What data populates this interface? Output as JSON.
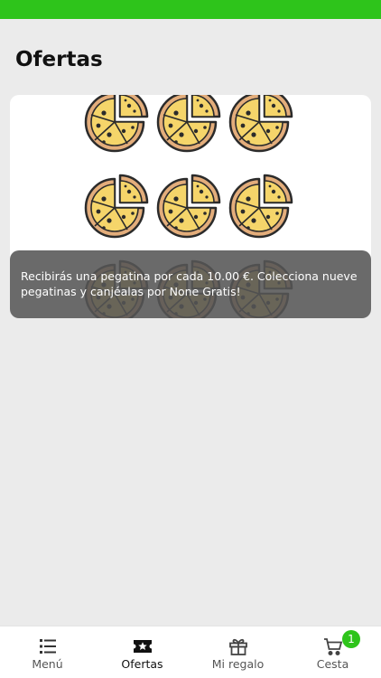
{
  "colors": {
    "accent": "#2ec41b",
    "background": "#ebebeb",
    "card": "#ffffff",
    "overlay": "#555555",
    "pizza_crust": "#e3ad7b",
    "pizza_cheese": "#f5d56a",
    "pizza_outline": "#2b2b2b"
  },
  "header": {
    "title": "Ofertas"
  },
  "offer": {
    "stamp_icon": "pizza-icon",
    "stamps_total": 9,
    "message": "Recibirás una pegatina por cada 10.00 €. Colecciona nueve pegatinas y canjéalas por None Gratis!"
  },
  "tabbar": {
    "items": [
      {
        "label": "Menú",
        "icon": "list-icon",
        "active": false
      },
      {
        "label": "Ofertas",
        "icon": "ticket-star-icon",
        "active": true
      },
      {
        "label": "Mi regalo",
        "icon": "gift-icon",
        "active": false
      },
      {
        "label": "Cesta",
        "icon": "cart-icon",
        "active": false,
        "badge": "1"
      }
    ]
  }
}
